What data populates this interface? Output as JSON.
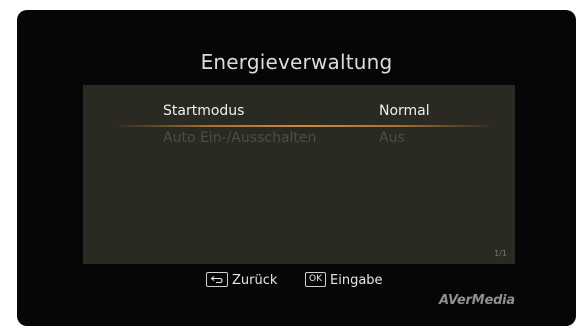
{
  "screen": {
    "title": "Energieverwaltung"
  },
  "menu": {
    "items": [
      {
        "label": "Startmodus",
        "value": "Normal",
        "selected": true
      },
      {
        "label": "Auto Ein-/Ausschalten",
        "value": "Aus",
        "selected": false
      }
    ],
    "page_indicator": "1/1"
  },
  "hints": {
    "back": {
      "key_icon": "return-arrow-icon",
      "label": "Zurück"
    },
    "enter": {
      "key_label": "OK",
      "label": "Eingabe"
    }
  },
  "brand": {
    "logo_text": "AVerMedia"
  },
  "colors": {
    "screen_bg": "#060606",
    "panel_bg": "#2a2a23",
    "selection_line": "#c88c3c",
    "active_text": "#f0f0f0",
    "inactive_text": "#4d4d45"
  }
}
